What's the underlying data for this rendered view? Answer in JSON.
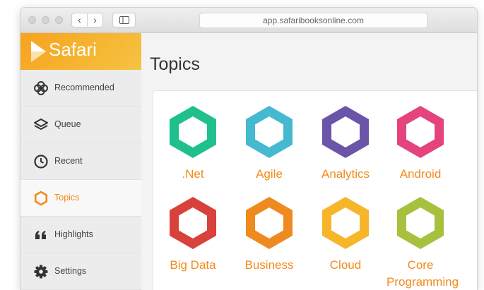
{
  "browser": {
    "url": "app.safaribooksonline.com",
    "back_label": "‹",
    "forward_label": "›"
  },
  "brand": {
    "name": "Safari"
  },
  "sidebar": {
    "items": [
      {
        "label": "Recommended",
        "icon": "recommended-icon"
      },
      {
        "label": "Queue",
        "icon": "layers-icon"
      },
      {
        "label": "Recent",
        "icon": "clock-icon"
      },
      {
        "label": "Topics",
        "icon": "hexagon-icon",
        "active": true
      },
      {
        "label": "Highlights",
        "icon": "quote-icon"
      },
      {
        "label": "Settings",
        "icon": "gear-icon"
      }
    ]
  },
  "main": {
    "title": "Topics",
    "topics": [
      {
        "name": ".Net",
        "color": "#1fc08e"
      },
      {
        "name": "Agile",
        "color": "#45b9cf"
      },
      {
        "name": "Analytics",
        "color": "#6a55a8"
      },
      {
        "name": "Android",
        "color": "#e4437e"
      },
      {
        "name": "Big Data",
        "color": "#d9413d"
      },
      {
        "name": "Business",
        "color": "#ee8a1f"
      },
      {
        "name": "Cloud",
        "color": "#f7b52a"
      },
      {
        "name": "Core Programming",
        "color": "#a5c13e"
      }
    ]
  },
  "colors": {
    "accent": "#f28a1a",
    "brand_gradient_start": "#f7a31d",
    "brand_gradient_end": "#f5c342"
  }
}
